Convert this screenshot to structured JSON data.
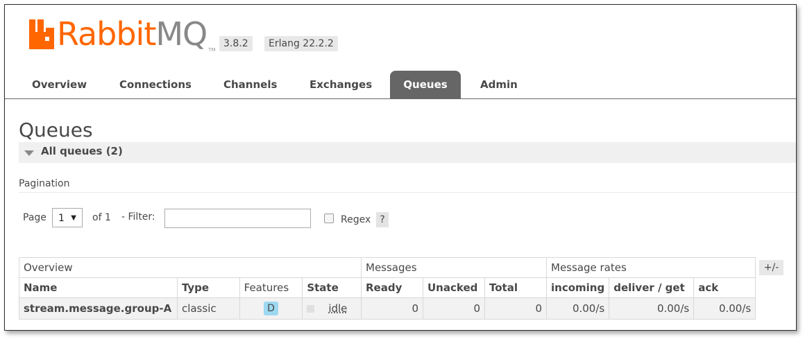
{
  "brand": {
    "name_part1": "Rabbit",
    "name_part2": "MQ",
    "trademark": "TM"
  },
  "versions": {
    "rabbitmq": "3.8.2",
    "erlang": "Erlang 22.2.2"
  },
  "nav": {
    "tabs": [
      {
        "label": "Overview",
        "active": false
      },
      {
        "label": "Connections",
        "active": false
      },
      {
        "label": "Channels",
        "active": false
      },
      {
        "label": "Exchanges",
        "active": false
      },
      {
        "label": "Queues",
        "active": true
      },
      {
        "label": "Admin",
        "active": false
      }
    ]
  },
  "page": {
    "title": "Queues",
    "section_label": "All queues (2)"
  },
  "pagination": {
    "label": "Pagination",
    "page_label": "Page",
    "page_value": "1",
    "of_label": "of 1",
    "filter_label": "- Filter:",
    "filter_value": "",
    "regex_label": "Regex",
    "help_label": "?"
  },
  "table": {
    "groups": [
      "Overview",
      "Messages",
      "Message rates"
    ],
    "columns": [
      "Name",
      "Type",
      "Features",
      "State",
      "Ready",
      "Unacked",
      "Total",
      "incoming",
      "deliver / get",
      "ack"
    ],
    "toggle_label": "+/-",
    "rows": [
      {
        "name": "stream.message.group-A",
        "type": "classic",
        "features": "D",
        "state": "idle",
        "ready": "0",
        "unacked": "0",
        "total": "0",
        "incoming": "0.00/s",
        "deliver_get": "0.00/s",
        "ack": "0.00/s"
      }
    ]
  },
  "colors": {
    "brand_orange": "#ff6600",
    "brand_gray": "#888888",
    "active_tab": "#666666",
    "feature_badge": "#9dd8f0"
  }
}
